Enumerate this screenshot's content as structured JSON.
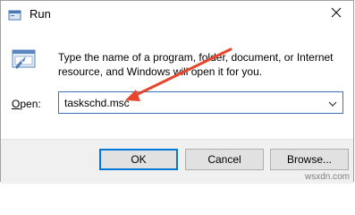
{
  "window": {
    "title": "Run",
    "title_icon": "run-icon",
    "close_icon": "close-icon"
  },
  "content": {
    "icon": "run-dialog-icon",
    "description": "Type the name of a program, folder, document, or Internet resource, and Windows will open it for you.",
    "open_label_prefix": "O",
    "open_label_rest": "pen:",
    "input_value": "taskschd.msc",
    "dropdown_icon": "chevron-down-icon"
  },
  "buttons": {
    "ok": "OK",
    "cancel": "Cancel",
    "browse": "Browse..."
  },
  "annotation": {
    "arrow_color": "#e8462c"
  },
  "watermark": "wsxdn.com",
  "colors": {
    "accent": "#0078d7",
    "input_border": "#3b73b9",
    "footer_bg": "#f0f0f0"
  }
}
